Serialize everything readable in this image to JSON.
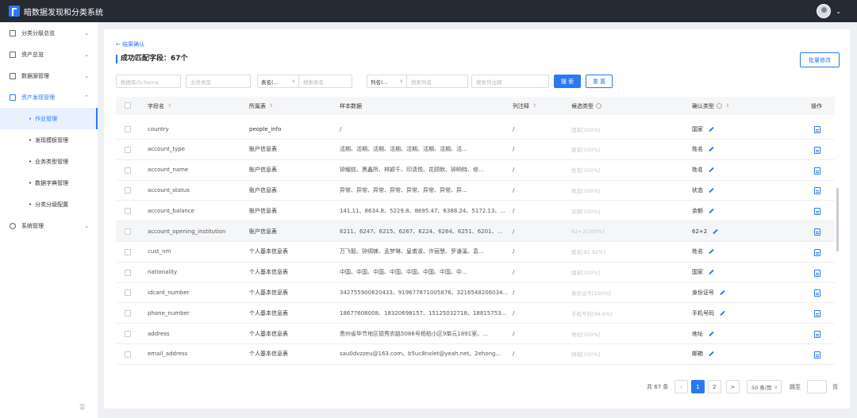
{
  "app": {
    "title": "暗数据发现和分类系统"
  },
  "sidebar": {
    "items": [
      {
        "label": "分类分级总览",
        "caret": "⌄"
      },
      {
        "label": "资产总览",
        "caret": "⌄"
      },
      {
        "label": "数据源管理",
        "caret": "⌄"
      },
      {
        "label": "资产发现管理",
        "caret": "⌃"
      },
      {
        "label": "系统管理",
        "caret": "⌄"
      }
    ],
    "subitems": [
      {
        "label": "作业管理"
      },
      {
        "label": "发现模板管理"
      },
      {
        "label": "业务类型管理"
      },
      {
        "label": "数据字典管理"
      },
      {
        "label": "分类分级配置"
      }
    ]
  },
  "header": {
    "back": "← 结果确认",
    "title": "成功匹配字段：67个",
    "batch": "批量修改"
  },
  "filters": {
    "schema_placeholder": "数据库/Schema",
    "biz_placeholder": "业务类型",
    "table_select": "表名(...",
    "table_placeholder": "搜索表名",
    "col_select": "列名(...",
    "col_placeholder": "搜索列名",
    "comment_placeholder": "搜索列注释",
    "search": "搜 索",
    "reset": "重 置"
  },
  "table": {
    "headers": {
      "field": "字段名",
      "table": "所属表",
      "sample": "样本数据",
      "comment": "列注释",
      "candidate": "候选类型",
      "confirm": "确认类型",
      "op": "操作"
    },
    "rows": [
      {
        "field": "country",
        "table": "people_info",
        "sample": "/",
        "comment": "/",
        "candidate": "国家[100%]",
        "confirm": "国家"
      },
      {
        "field": "account_type",
        "table": "账户信息表",
        "sample": "活期、活期、活期、活期、活期、活期、活期、活...",
        "comment": "/",
        "candidate": "姓名[100%]",
        "confirm": "姓名"
      },
      {
        "field": "account_name",
        "table": "账户信息表",
        "sample": "钟耀鉉、黑鑫所、林颖千、印清悦、花顾默、钟晌特、修...",
        "comment": "/",
        "candidate": "姓名[100%]",
        "confirm": "姓名"
      },
      {
        "field": "account_status",
        "table": "账户信息表",
        "sample": "异常、异常、异常、异常、异常、异常、异常、异...",
        "comment": "/",
        "candidate": "状态[100%]",
        "confirm": "状态"
      },
      {
        "field": "account_balance",
        "table": "账户信息表",
        "sample": "141.11、8634.8、5229.8、8695.47、6388.24、5172.13、...",
        "comment": "/",
        "candidate": "余额[100%]",
        "confirm": "余额"
      },
      {
        "field": "account_opening_institution",
        "table": "账户信息表",
        "sample": "6211、6247、6215、6267、6224、6264、6251、6201、...",
        "comment": "/",
        "candidate": "62+2[100%]",
        "confirm": "62+2"
      },
      {
        "field": "cust_nm",
        "table": "个人基本信息表",
        "sample": "万飞毅、钟绸镓、孟梦琳、皇甫淑、许丽慧、罗谦溪、袁...",
        "comment": "/",
        "candidate": "姓名[91.92%]",
        "confirm": "姓名"
      },
      {
        "field": "nationality",
        "table": "个人基本信息表",
        "sample": "中国、中国、中国、中国、中国、中国、中国、中...",
        "comment": "/",
        "candidate": "国家[100%]",
        "confirm": "国家"
      },
      {
        "field": "idcard_number",
        "table": "个人基本信息表",
        "sample": "342755900620433、919677871005876、3216548206034...",
        "comment": "/",
        "candidate": "身份证号[100%]",
        "confirm": "身份证号"
      },
      {
        "field": "phone_number",
        "table": "个人基本信息表",
        "sample": "18677608008、18320698157、15125032718、18815753...",
        "comment": "/",
        "candidate": "手机号码[98.6%]",
        "confirm": "手机号码"
      },
      {
        "field": "address",
        "table": "个人基本信息表",
        "sample": "贵州省毕节地区德秀农路5086号杨柏小区9单元1891室、...",
        "comment": "/",
        "candidate": "地址[100%]",
        "confirm": "地址"
      },
      {
        "field": "email_address",
        "table": "个人基本信息表",
        "sample": "sau0dvzzeu@163.com、b5uc8nxlet@yeah.net、2ehong...",
        "comment": "/",
        "candidate": "邮箱[100%]",
        "confirm": "邮箱"
      }
    ]
  },
  "pagination": {
    "total": "共 67 条",
    "prev": "<",
    "pages": [
      "1",
      "2"
    ],
    "next": ">",
    "page_size": "50 条/页",
    "jump_label": "跳至",
    "page_suffix": "页",
    "current": 1
  },
  "colors": {
    "accent": "#2b79f2",
    "topbar": "#262a33"
  }
}
